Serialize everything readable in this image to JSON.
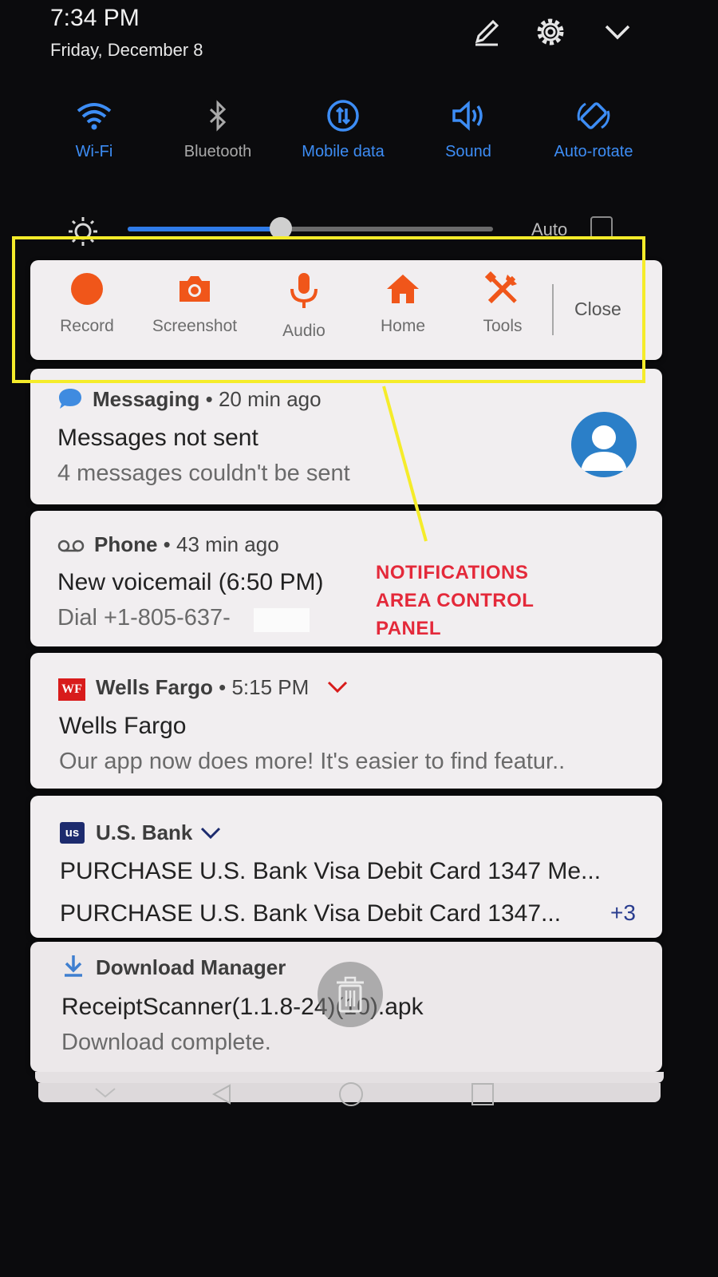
{
  "status": {
    "time": "7:34 PM",
    "date": "Friday, December 8",
    "icons": [
      "edit-icon",
      "gear-icon",
      "chevron-down-icon"
    ]
  },
  "quick_settings": [
    {
      "label": "Wi-Fi",
      "icon": "wifi-icon",
      "active": true
    },
    {
      "label": "Bluetooth",
      "icon": "bluetooth-icon",
      "active": false
    },
    {
      "label": "Mobile data",
      "icon": "mobile-data-icon",
      "active": true
    },
    {
      "label": "Sound",
      "icon": "sound-icon",
      "active": true
    },
    {
      "label": "Auto-rotate",
      "icon": "auto-rotate-icon",
      "active": true
    }
  ],
  "brightness": {
    "level": 0.42,
    "auto_label": "Auto",
    "auto_checked": false
  },
  "control_panel": {
    "items": [
      {
        "label": "Record",
        "icon": "record-icon"
      },
      {
        "label": "Screenshot",
        "icon": "camera-icon"
      },
      {
        "label": "Audio",
        "icon": "microphone-icon"
      },
      {
        "label": "Home",
        "icon": "home-icon"
      },
      {
        "label": "Tools",
        "icon": "tools-icon"
      }
    ],
    "close_label": "Close",
    "accent": "#f0561a"
  },
  "annotation": {
    "line1": "NOTIFICATIONS",
    "line2": "AREA CONTROL",
    "line3": "PANEL",
    "color": "#e4293a",
    "box_color": "#f5ec2a"
  },
  "notifications": [
    {
      "app": "Messaging",
      "time": "20 min ago",
      "title": "Messages not sent",
      "body": "4 messages couldn't be sent"
    },
    {
      "app": "Phone",
      "time": "43 min ago",
      "title": "New voicemail (6:50 PM)",
      "body": "Dial +1-805-637-"
    },
    {
      "app": "Wells Fargo",
      "time": "5:15 PM",
      "logo": "WF",
      "title": "Wells Fargo",
      "body": "Our app now does more! It's easier to find featur.."
    },
    {
      "app": "U.S. Bank",
      "logo": "us",
      "line1": "PURCHASE U.S. Bank  Visa  Debit Card 1347 Me...",
      "line2": "PURCHASE U.S. Bank  Visa  Debit Card 1347...",
      "more": "+3"
    },
    {
      "app": "Download Manager",
      "title": "ReceiptScanner(1.1.8-24)(10).apk",
      "body": "Download complete."
    }
  ]
}
